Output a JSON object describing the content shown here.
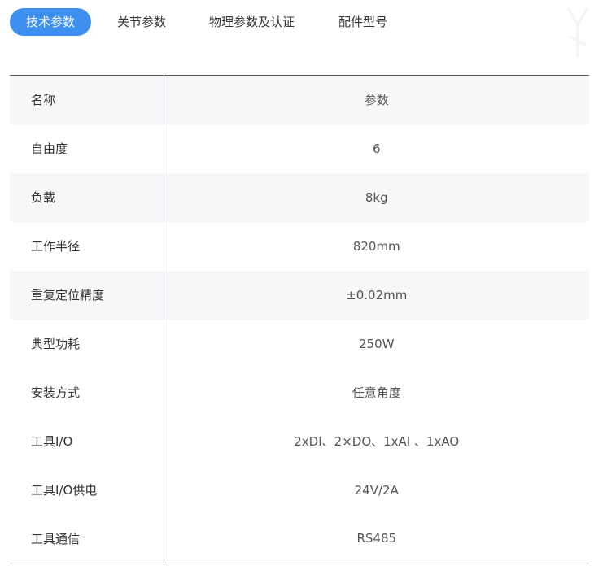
{
  "tabs": [
    {
      "label": "技术参数",
      "active": true
    },
    {
      "label": "关节参数",
      "active": false
    },
    {
      "label": "物理参数及认证",
      "active": false
    },
    {
      "label": "配件型号",
      "active": false
    }
  ],
  "table": {
    "header": {
      "name": "名称",
      "value": "参数"
    },
    "rows": [
      {
        "name": "自由度",
        "value": "6"
      },
      {
        "name": "负载",
        "value": "8kg"
      },
      {
        "name": "工作半径",
        "value": "820mm"
      },
      {
        "name": "重复定位精度",
        "value": "±0.02mm"
      },
      {
        "name": "典型功耗",
        "value": "250W"
      },
      {
        "name": "安装方式",
        "value": "任意角度"
      },
      {
        "name": "工具I/O",
        "value": "2xDI、2×DO、1xAI 、1xAO"
      },
      {
        "name": "工具I/O供电",
        "value": "24V/2A"
      },
      {
        "name": "工具通信",
        "value": "RS485"
      }
    ]
  },
  "colors": {
    "accent": "#3d8ff0",
    "row_shade": "#f7f7f9",
    "text": "#333333"
  }
}
